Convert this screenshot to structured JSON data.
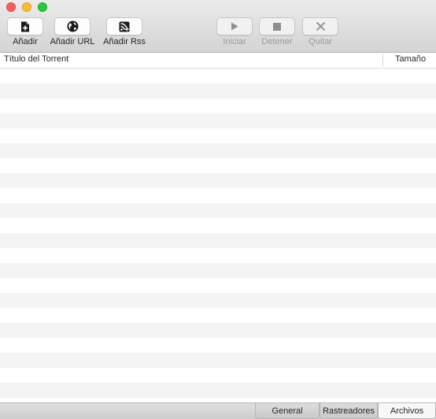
{
  "toolbar": {
    "buttons": [
      {
        "label": "Añadir",
        "icon": "add-file-icon",
        "enabled": true
      },
      {
        "label": "Añadir URL",
        "icon": "globe-icon",
        "enabled": true
      },
      {
        "label": "Añadir Rss",
        "icon": "rss-add-icon",
        "enabled": true
      },
      {
        "label": "Iniciar",
        "icon": "play-icon",
        "enabled": false
      },
      {
        "label": "Detener",
        "icon": "stop-icon",
        "enabled": false
      },
      {
        "label": "Quitar",
        "icon": "close-x-icon",
        "enabled": false
      }
    ]
  },
  "table": {
    "columns": [
      "Título del Torrent",
      "Tamaño"
    ],
    "rows": []
  },
  "bottom_tabs": [
    {
      "label": "General",
      "active": false
    },
    {
      "label": "Rastreadores",
      "active": false
    },
    {
      "label": "Archivos",
      "active": true
    }
  ],
  "colors": {
    "close": "#fc5f57",
    "minimize": "#fdbc2e",
    "maximize": "#28c840",
    "stripe": "#f4f4f4"
  }
}
